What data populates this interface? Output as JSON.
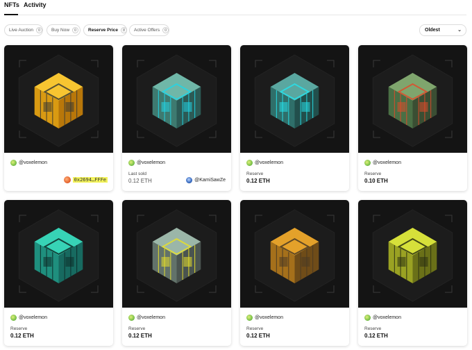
{
  "tabs": {
    "nfts": "NFTs",
    "activity": "Activity"
  },
  "filters": [
    {
      "label": "Live Auction",
      "count": "0"
    },
    {
      "label": "Buy Now",
      "count": "0"
    },
    {
      "label": "Reserve Price",
      "count": "8"
    },
    {
      "label": "Active Offers",
      "count": "0"
    }
  ],
  "sort": {
    "selected": "Oldest"
  },
  "cards": [
    {
      "owner": "@voxelemon",
      "label": "",
      "value": "",
      "address": "0x2694…FFFe",
      "palette": "gold"
    },
    {
      "owner": "@voxelemon",
      "label": "Last sold",
      "value": "0.12 ETH",
      "buyer": "@KamiSawZe",
      "palette": "teal"
    },
    {
      "owner": "@voxelemon",
      "label": "Reserve",
      "value": "0.12 ETH",
      "palette": "cyan"
    },
    {
      "owner": "@voxelemon",
      "label": "Reserve",
      "value": "0.10 ETH",
      "palette": "redgreen"
    },
    {
      "owner": "@voxelemon",
      "label": "Reserve",
      "value": "0.12 ETH",
      "palette": "frame"
    },
    {
      "owner": "@voxelemon",
      "label": "Reserve",
      "value": "0.12 ETH",
      "palette": "yellowteal"
    },
    {
      "owner": "@voxelemon",
      "label": "Reserve",
      "value": "0.12 ETH",
      "palette": "amber"
    },
    {
      "owner": "@voxelemon",
      "label": "Reserve",
      "value": "0.12 ETH",
      "palette": "lime"
    }
  ],
  "colors": {
    "accent": "#111111",
    "highlight": "#f3f35a",
    "card_art_bg": "#141414"
  },
  "icons": {
    "sort_chevron": "chevron-down-icon"
  }
}
